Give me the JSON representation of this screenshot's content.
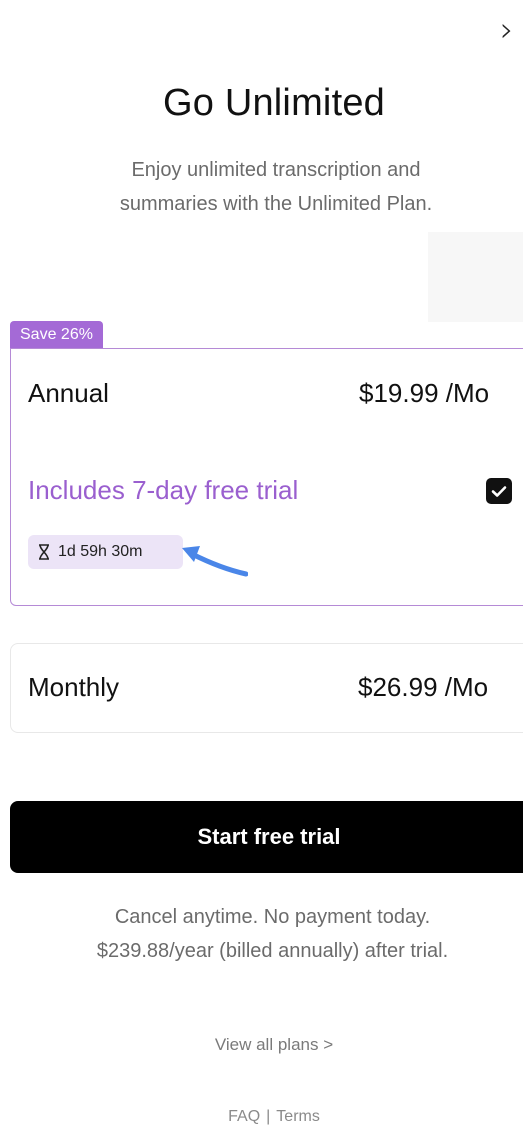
{
  "header": {
    "close_glyph": "›",
    "title": "Go Unlimited",
    "subtitle_line1": "Enjoy unlimited transcription and",
    "subtitle_line2": "summaries with the Unlimited Plan."
  },
  "plans": {
    "annual": {
      "badge": "Save 26%",
      "name": "Annual",
      "price": "$19.99 /Mo",
      "trial_text": "Includes 7-day free trial",
      "trial_checked": true,
      "countdown": "1d 59h 30m"
    },
    "monthly": {
      "name": "Monthly",
      "price": "$26.99 /Mo"
    }
  },
  "cta": {
    "label": "Start free trial"
  },
  "fine_print": {
    "line1": "Cancel anytime. No payment today.",
    "line2": "$239.88/year (billed annually) after trial."
  },
  "links": {
    "view_all": "View all plans >",
    "faq": "FAQ",
    "separator": "|",
    "terms": "Terms"
  },
  "colors": {
    "accent": "#9a5fcf",
    "badge_bg": "#a46ad6",
    "timer_bg": "#ece4f7",
    "cta_bg": "#000000",
    "annotation_arrow": "#4a86e8"
  },
  "icons": {
    "close": "chevron-right-icon",
    "timer": "hourglass-icon",
    "check": "checkmark-icon"
  }
}
